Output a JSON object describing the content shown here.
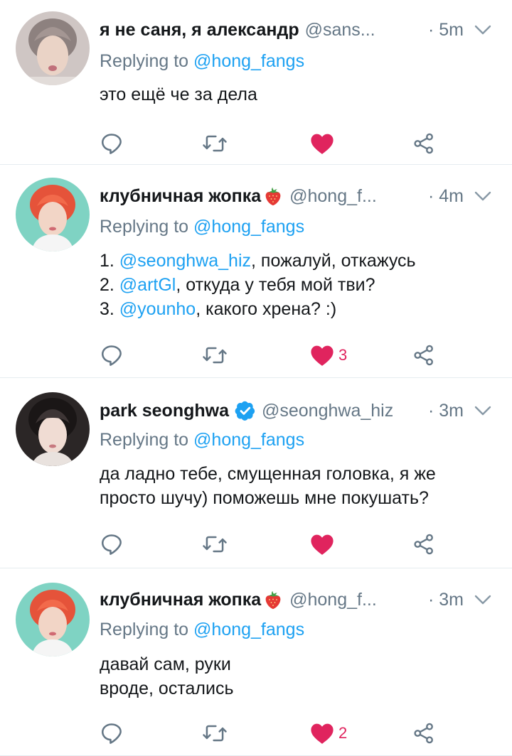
{
  "tweets": [
    {
      "name": "я не саня, я александр",
      "name_emoji": "",
      "verified": false,
      "handle": "@sans...",
      "time": "· 5m",
      "replying_prefix": "Replying to",
      "replying_to": "@hong_fangs",
      "lines": [
        [
          {
            "t": "это ещё че за дела",
            "m": false
          }
        ]
      ],
      "likes": ""
    },
    {
      "name": "клубничная жопка",
      "name_emoji": "strawberry-emoji",
      "verified": false,
      "handle": "@hong_f...",
      "time": "· 4m",
      "replying_prefix": "Replying to",
      "replying_to": "@hong_fangs",
      "lines": [
        [
          {
            "t": "1. ",
            "m": false
          },
          {
            "t": "@seonghwa_hiz",
            "m": true
          },
          {
            "t": ", пожалуй, откажусь",
            "m": false
          }
        ],
        [
          {
            "t": "2. ",
            "m": false
          },
          {
            "t": "@artGl",
            "m": true
          },
          {
            "t": ", откуда у тебя мой тви?",
            "m": false
          }
        ],
        [
          {
            "t": "3. ",
            "m": false
          },
          {
            "t": "@younho",
            "m": true
          },
          {
            "t": ", какого хрена? :)",
            "m": false
          }
        ]
      ],
      "likes": "3"
    },
    {
      "name": "park seonghwa",
      "name_emoji": "",
      "verified": true,
      "handle": "@seonghwa_hiz",
      "time": "· 3m",
      "replying_prefix": "Replying to",
      "replying_to": "@hong_fangs",
      "lines": [
        [
          {
            "t": "да ладно тебе, смущенная головка, я же",
            "m": false
          }
        ],
        [
          {
            "t": "просто шучу) поможешь мне покушать?",
            "m": false
          }
        ]
      ],
      "likes": ""
    },
    {
      "name": "клубничная жопка",
      "name_emoji": "strawberry-emoji",
      "verified": false,
      "handle": "@hong_f...",
      "time": "· 3m",
      "replying_prefix": "Replying to",
      "replying_to": "@hong_fangs",
      "lines": [
        [
          {
            "t": "давай сам, руки",
            "m": false
          }
        ],
        [
          {
            "t": "вроде, остались",
            "m": false
          }
        ]
      ],
      "likes": "2"
    }
  ],
  "icons": {
    "reply": "reply-icon",
    "retweet": "retweet-icon",
    "like": "heart-icon-liked",
    "share": "share-icon",
    "menu": "chevron-down-icon",
    "verified": "verified-badge-icon"
  },
  "colors": {
    "mention": "#1da1f2",
    "secondary_text": "#657786",
    "like": "#e0245e",
    "icon": "#657786",
    "divider": "#e6ecf0"
  }
}
